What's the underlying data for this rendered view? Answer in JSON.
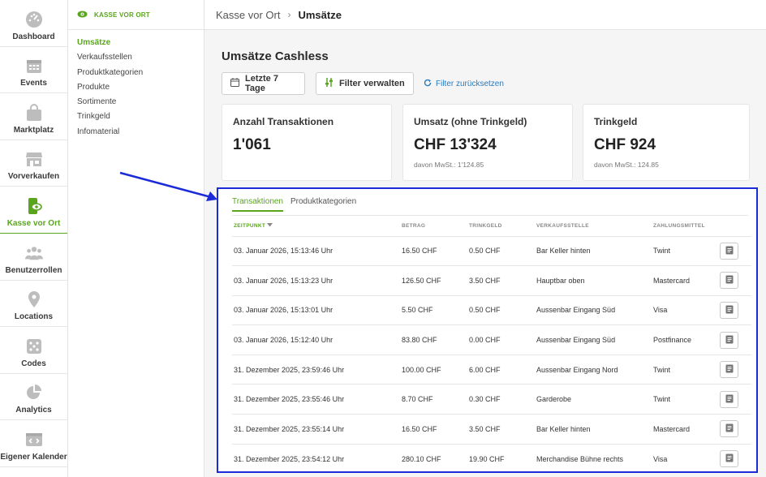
{
  "rail": [
    {
      "label": "Dashboard",
      "icon": "dashboard-icon"
    },
    {
      "label": "Events",
      "icon": "calendar-icon"
    },
    {
      "label": "Marktplatz",
      "icon": "shopping-bag-icon"
    },
    {
      "label": "Vorverkaufen",
      "icon": "store-icon"
    },
    {
      "label": "Kasse vor Ort",
      "icon": "cash-register-icon"
    },
    {
      "label": "Benutzerrollen",
      "icon": "users-icon"
    },
    {
      "label": "Locations",
      "icon": "location-pin-icon"
    },
    {
      "label": "Codes",
      "icon": "dice-icon"
    },
    {
      "label": "Analytics",
      "icon": "pie-chart-icon"
    },
    {
      "label": "Eigener Kalender",
      "icon": "code-calendar-icon"
    }
  ],
  "subnav": {
    "title": "KASSE VOR ORT",
    "items": [
      "Umsätze",
      "Verkaufsstellen",
      "Produktkategorien",
      "Produkte",
      "Sortimente",
      "Trinkgeld",
      "Infomaterial"
    ]
  },
  "breadcrumb": {
    "parent": "Kasse vor Ort",
    "separator": "›",
    "current": "Umsätze"
  },
  "page": {
    "title": "Umsätze Cashless",
    "filter_date": "Letzte 7 Tage",
    "filter_manage": "Filter verwalten",
    "filter_reset": "Filter zurücksetzen"
  },
  "cards": [
    {
      "title": "Anzahl Transaktionen",
      "value": "1'061",
      "sub": ""
    },
    {
      "title": "Umsatz (ohne Trinkgeld)",
      "value": "CHF 13'324",
      "sub": "davon MwSt.: 1'124.85"
    },
    {
      "title": "Trinkgeld",
      "value": "CHF 924",
      "sub": "davon MwSt.: 124.85"
    }
  ],
  "tabs": [
    "Transaktionen",
    "Produktkategorien"
  ],
  "table": {
    "headers": [
      "ZEITPUNKT",
      "BETRAG",
      "TRINKGELD",
      "VERKAUFSSTELLE",
      "ZAHLUNGSMITTEL"
    ],
    "rows": [
      [
        "03. Januar 2026, 15:13:46 Uhr",
        "16.50 CHF",
        "0.50 CHF",
        "Bar Keller hinten",
        "Twint"
      ],
      [
        "03. Januar 2026, 15:13:23 Uhr",
        "126.50 CHF",
        "3.50 CHF",
        "Hauptbar oben",
        "Mastercard"
      ],
      [
        "03. Januar 2026, 15:13:01 Uhr",
        "5.50 CHF",
        "0.50 CHF",
        "Aussenbar Eingang Süd",
        "Visa"
      ],
      [
        "03. Januar 2026, 15:12:40 Uhr",
        "83.80 CHF",
        "0.00 CHF",
        "Aussenbar Eingang Süd",
        "Postfinance"
      ],
      [
        "31. Dezember 2025, 23:59:46 Uhr",
        "100.00 CHF",
        "6.00 CHF",
        "Aussenbar Eingang Nord",
        "Twint"
      ],
      [
        "31. Dezember 2025, 23:55:46 Uhr",
        "8.70 CHF",
        "0.30 CHF",
        "Garderobe",
        "Twint"
      ],
      [
        "31. Dezember 2025, 23:55:14 Uhr",
        "16.50 CHF",
        "3.50 CHF",
        "Bar Keller hinten",
        "Mastercard"
      ],
      [
        "31. Dezember 2025, 23:54:12 Uhr",
        "280.10 CHF",
        "19.90 CHF",
        "Merchandise Bühne rechts",
        "Visa"
      ]
    ]
  },
  "colors": {
    "accent": "#5aa51e",
    "highlight": "#1c2bd8",
    "link": "#2b7bbd"
  }
}
